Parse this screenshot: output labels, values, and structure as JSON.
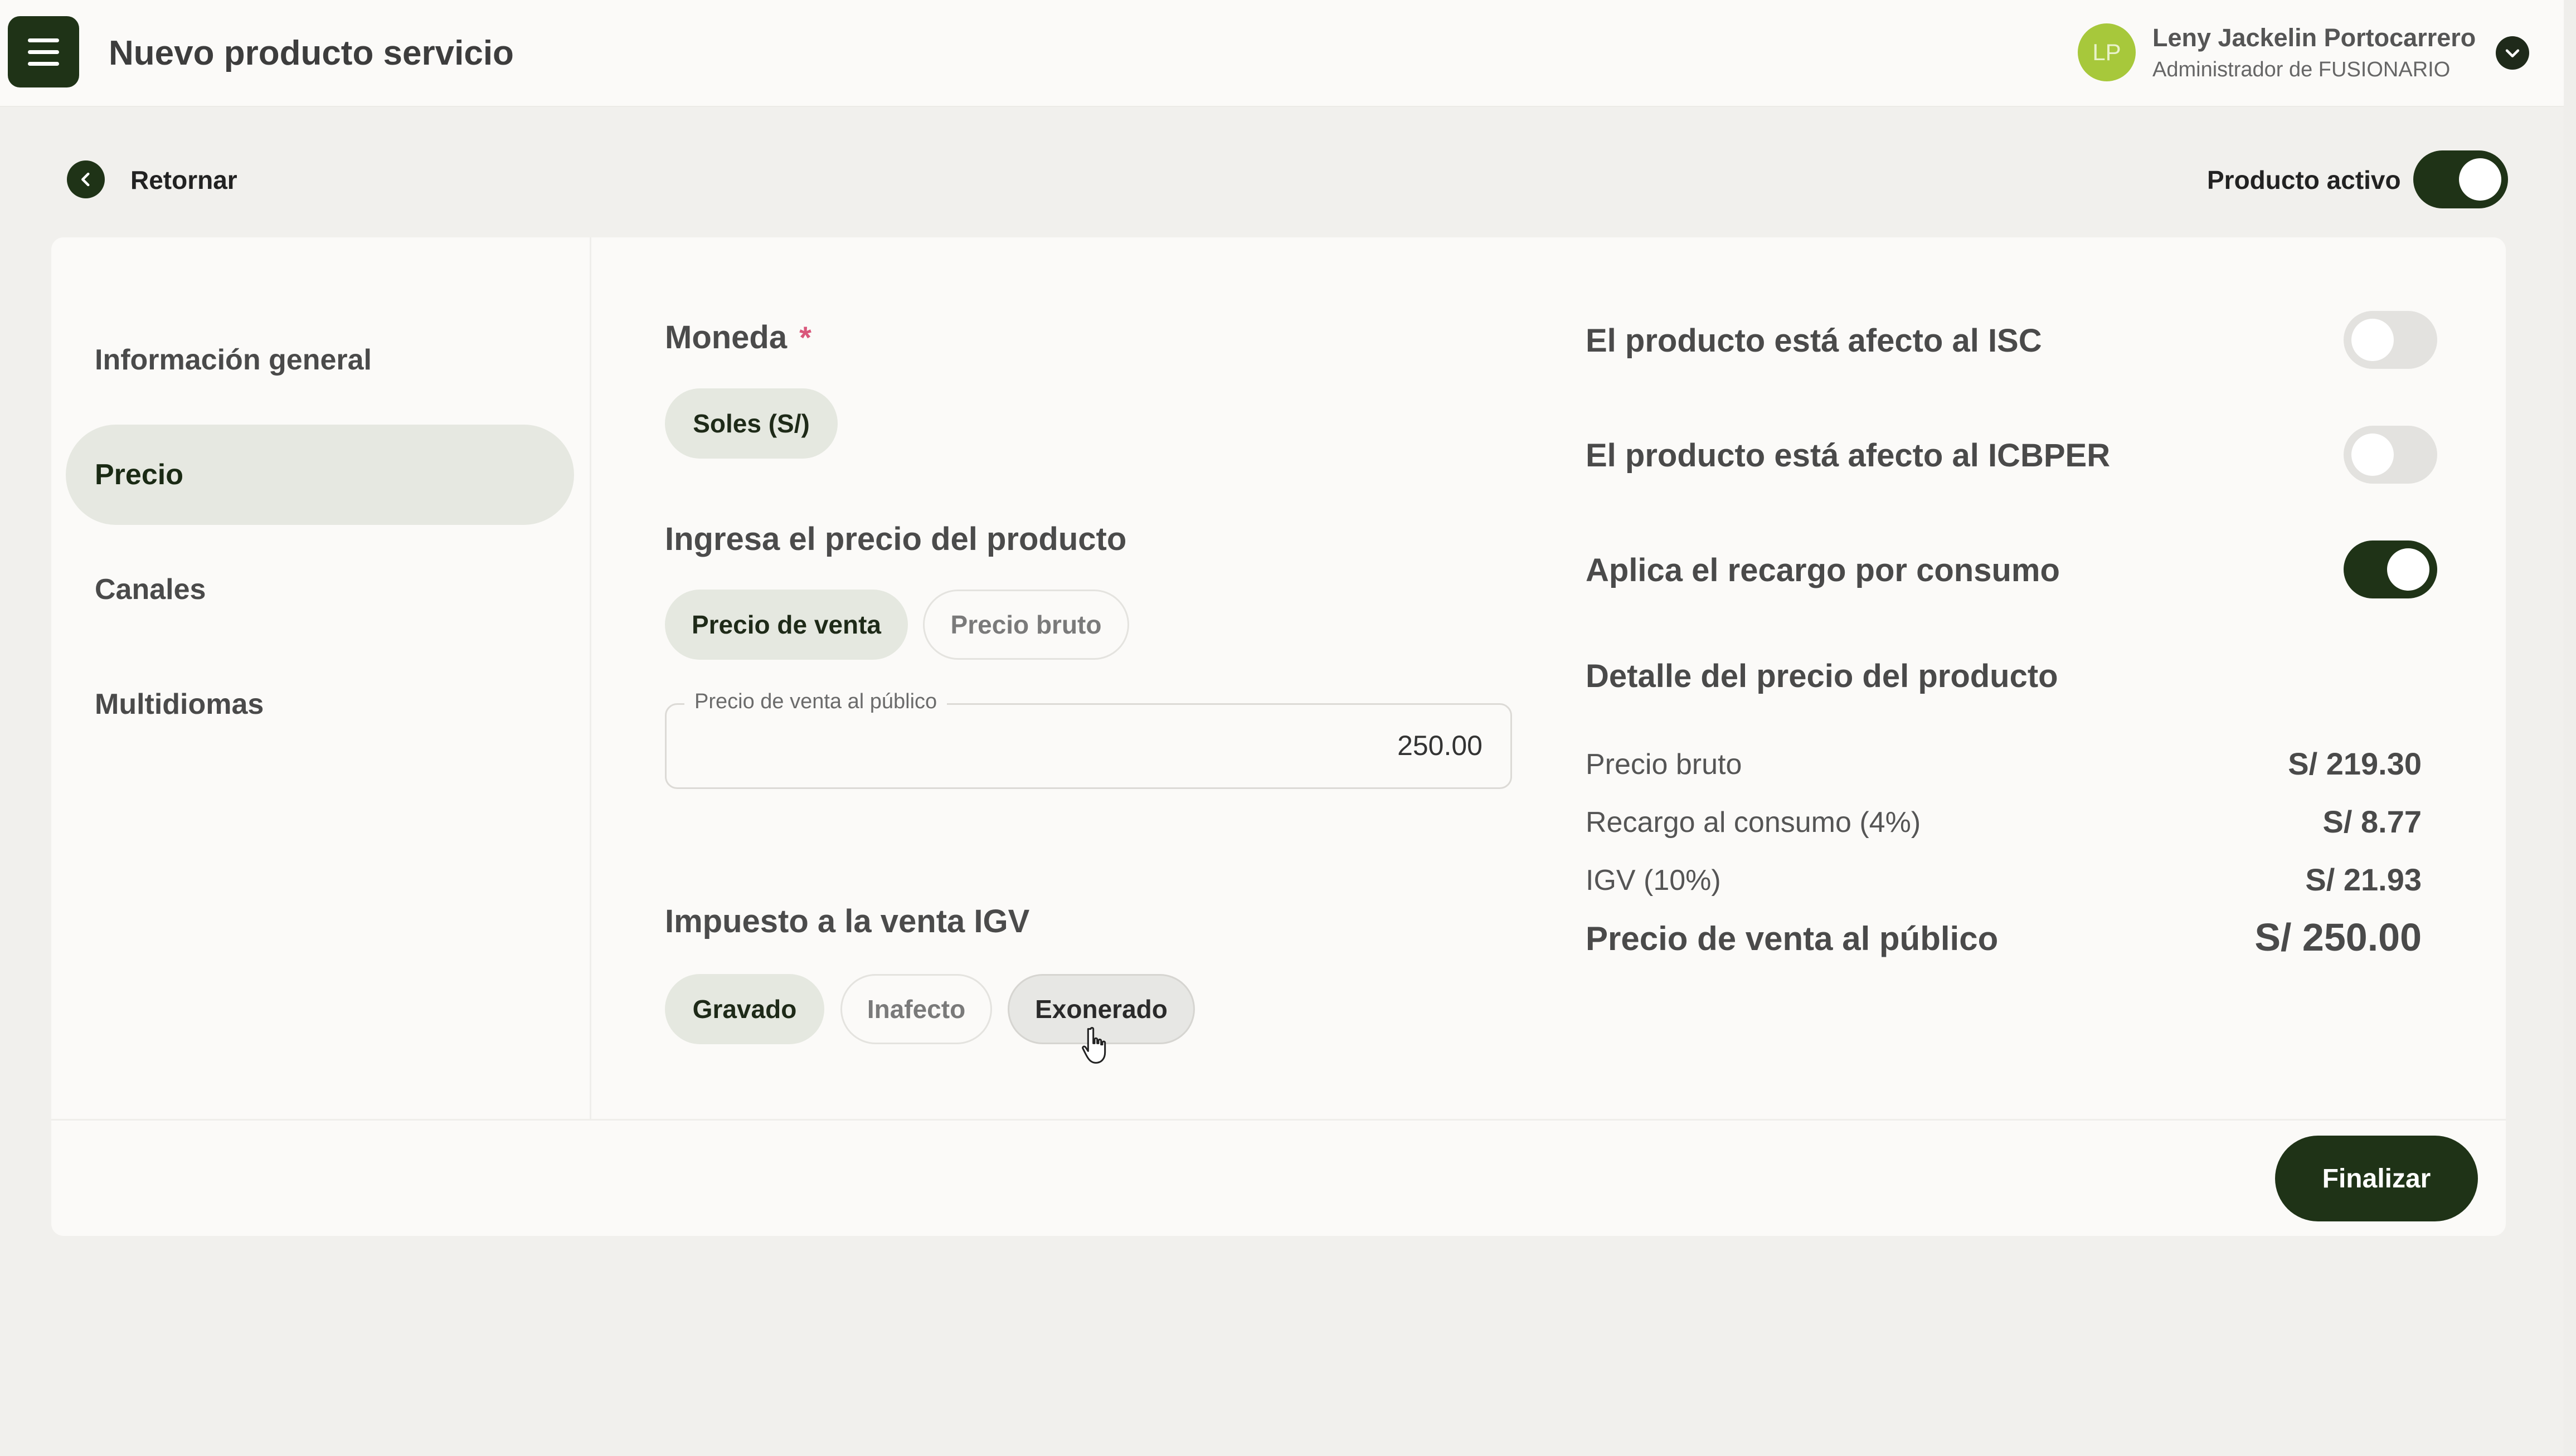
{
  "header": {
    "title": "Nuevo producto servicio",
    "menu_icon": "hamburger-icon",
    "user": {
      "initials": "LP",
      "name": "Leny Jackelin Portocarrero",
      "role": "Administrador de FUSIONARIO",
      "avatar_color": "#a7c83b"
    }
  },
  "subheader": {
    "back_label": "Retornar",
    "active_label": "Producto activo",
    "active_on": true
  },
  "sidebar": {
    "items": [
      {
        "label": "Información general",
        "active": false
      },
      {
        "label": "Precio",
        "active": true
      },
      {
        "label": "Canales",
        "active": false
      },
      {
        "label": "Multidiomas",
        "active": false
      }
    ]
  },
  "currency": {
    "title": "Moneda",
    "required_mark": "*",
    "selected": "Soles (S/)"
  },
  "price_input": {
    "title": "Ingresa el precio del producto",
    "modes": [
      "Precio de venta",
      "Precio bruto"
    ],
    "selected_mode": "Precio de venta",
    "field_label": "Precio de venta al público",
    "field_value": "250.00"
  },
  "igv": {
    "title": "Impuesto a la venta IGV",
    "options": [
      "Gravado",
      "Inafecto",
      "Exonerado"
    ],
    "selected": "Gravado",
    "hovered": "Exonerado"
  },
  "toggles": [
    {
      "label": "El producto está afecto al ISC",
      "on": false
    },
    {
      "label": "El producto está afecto al ICBPER",
      "on": false
    },
    {
      "label": "Aplica el recargo por consumo",
      "on": true
    }
  ],
  "detail": {
    "title": "Detalle del precio del producto",
    "rows": [
      {
        "label": "Precio bruto",
        "value": "S/ 219.30"
      },
      {
        "label": "Recargo al consumo (4%)",
        "value": "S/ 8.77"
      },
      {
        "label": "IGV (10%)",
        "value": "S/ 21.93"
      }
    ],
    "total_label": "Precio de venta al público",
    "total_value": "S/ 250.00"
  },
  "footer": {
    "finish_label": "Finalizar"
  },
  "colors": {
    "brand_dark": "#1f3317",
    "chip_selected": "#e5e8e0",
    "required": "#d9577b"
  }
}
